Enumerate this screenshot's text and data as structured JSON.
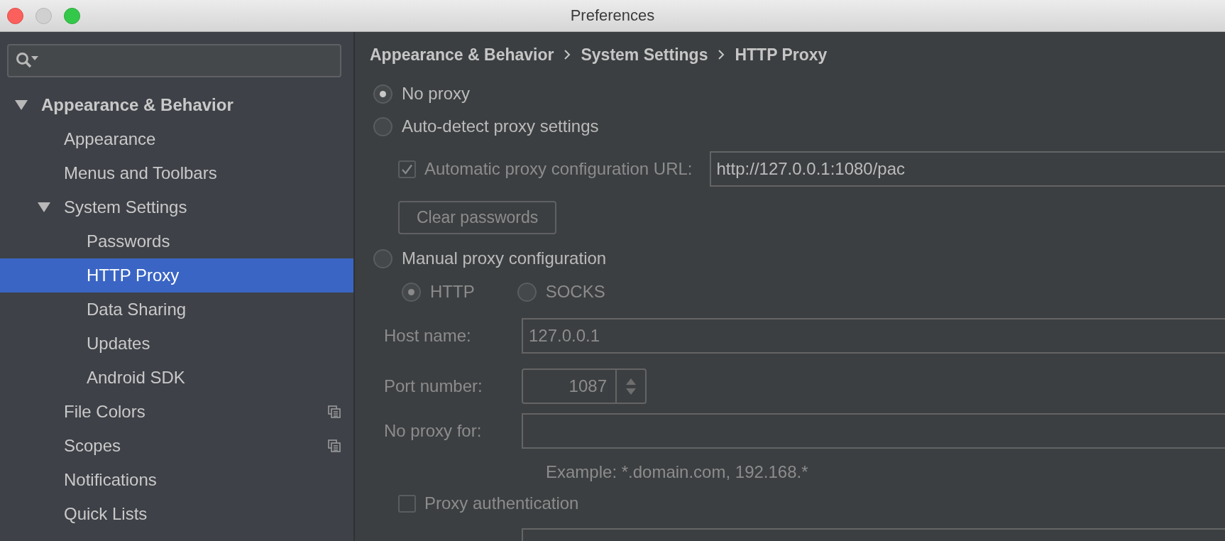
{
  "window": {
    "title": "Preferences"
  },
  "tree": [
    {
      "label": "Appearance & Behavior",
      "expanded": true,
      "selected": false,
      "children": [
        {
          "label": "Appearance",
          "selected": false
        },
        {
          "label": "Menus and Toolbars",
          "selected": false
        },
        {
          "label": "System Settings",
          "expanded": true,
          "selected": false,
          "children": [
            {
              "label": "Passwords",
              "selected": false
            },
            {
              "label": "HTTP Proxy",
              "selected": true
            },
            {
              "label": "Data Sharing",
              "selected": false
            },
            {
              "label": "Updates",
              "selected": false
            },
            {
              "label": "Android SDK",
              "selected": false
            }
          ]
        },
        {
          "label": "File Colors",
          "selected": false,
          "project_level": true
        },
        {
          "label": "Scopes",
          "selected": false,
          "project_level": true
        },
        {
          "label": "Notifications",
          "selected": false
        },
        {
          "label": "Quick Lists",
          "selected": false
        }
      ]
    }
  ],
  "breadcrumb": [
    "Appearance & Behavior",
    "System Settings",
    "HTTP Proxy"
  ],
  "form": [
    {
      "kind": "radio",
      "label": "No proxy",
      "selected": true,
      "disabled": false
    },
    {
      "kind": "radio",
      "label": "Auto-detect proxy settings",
      "selected": false,
      "disabled": false
    },
    {
      "kind": "checkbox_url",
      "label": "Automatic proxy configuration URL:",
      "checked": true,
      "disabled": true,
      "value": "http://127.0.0.1:1080/pac"
    },
    {
      "kind": "button",
      "label": "Clear passwords",
      "disabled": true
    },
    {
      "kind": "radio",
      "label": "Manual proxy configuration",
      "selected": false,
      "disabled": false
    },
    {
      "kind": "radio_pair",
      "disabled": true,
      "options": [
        {
          "label": "HTTP",
          "selected": true
        },
        {
          "label": "SOCKS",
          "selected": false
        }
      ]
    },
    {
      "kind": "field",
      "label": "Host name:",
      "value": "127.0.0.1",
      "disabled": true
    },
    {
      "kind": "spinner",
      "label": "Port number:",
      "value": "1087",
      "disabled": true
    },
    {
      "kind": "field",
      "label": "No proxy for:",
      "disabled": true
    },
    {
      "kind": "hint",
      "text": "Example: *.domain.com, 192.168.*"
    },
    {
      "kind": "checkbox",
      "label": "Proxy authentication",
      "checked": false,
      "disabled": true
    },
    {
      "kind": "field"
    }
  ]
}
